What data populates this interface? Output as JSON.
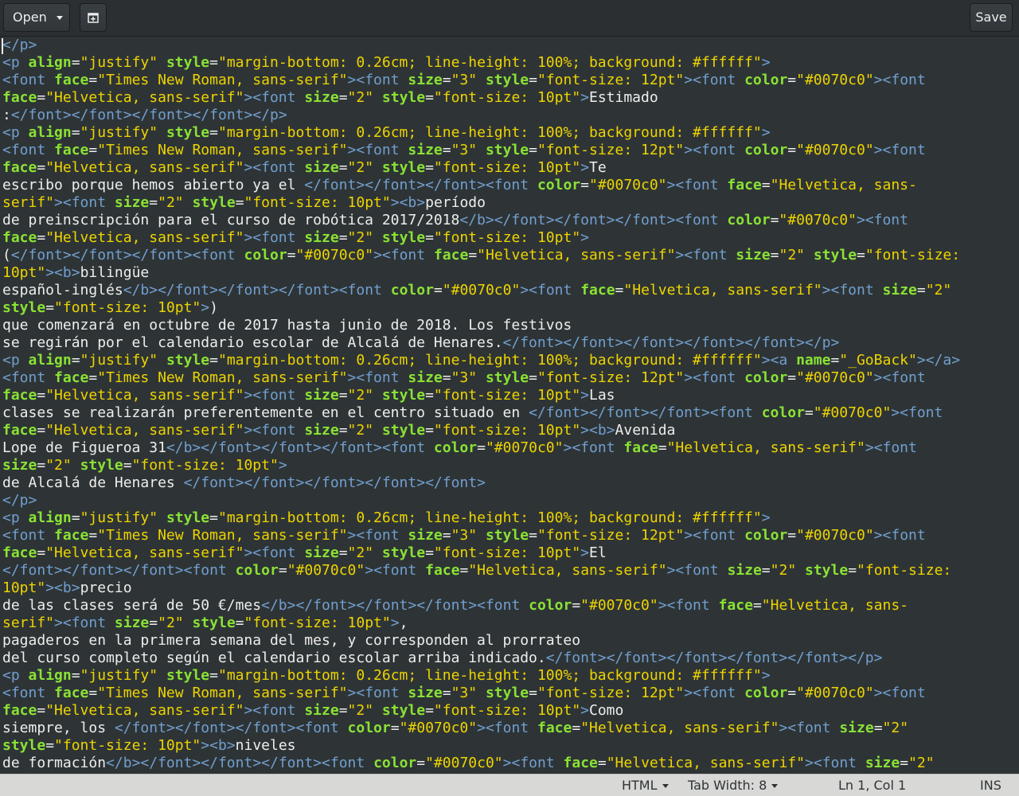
{
  "header": {
    "open_label": "Open",
    "save_label": "Save",
    "new_tab_icon": "new-tab-icon"
  },
  "editor": {
    "lines": [
      "</p>",
      "<p align=\"justify\" style=\"margin-bottom: 0.26cm; line-height: 100%; background: #ffffff\">",
      "<font face=\"Times New Roman, sans-serif\"><font size=\"3\" style=\"font-size: 12pt\"><font color=\"#0070c0\"><font",
      "face=\"Helvetica, sans-serif\"><font size=\"2\" style=\"font-size: 10pt\">Estimado",
      ":</font></font></font></font></p>",
      "<p align=\"justify\" style=\"margin-bottom: 0.26cm; line-height: 100%; background: #ffffff\">",
      "<font face=\"Times New Roman, sans-serif\"><font size=\"3\" style=\"font-size: 12pt\"><font color=\"#0070c0\"><font",
      "face=\"Helvetica, sans-serif\"><font size=\"2\" style=\"font-size: 10pt\">Te",
      "escribo porque hemos abierto ya el </font></font></font><font color=\"#0070c0\"><font face=\"Helvetica, sans-",
      "serif\"><font size=\"2\" style=\"font-size: 10pt\"><b>período",
      "de preinscripción para el curso de robótica 2017/2018</b></font></font></font><font color=\"#0070c0\"><font",
      "face=\"Helvetica, sans-serif\"><font size=\"2\" style=\"font-size: 10pt\">",
      "(</font></font></font><font color=\"#0070c0\"><font face=\"Helvetica, sans-serif\"><font size=\"2\" style=\"font-size:",
      "10pt\"><b>bilingüe",
      "español-inglés</b></font></font></font><font color=\"#0070c0\"><font face=\"Helvetica, sans-serif\"><font size=\"2\"",
      "style=\"font-size: 10pt\">)",
      "que comenzará en octubre de 2017 hasta junio de 2018. Los festivos",
      "se regirán por el calendario escolar de Alcalá de Henares.</font></font></font></font></font></p>",
      "<p align=\"justify\" style=\"margin-bottom: 0.26cm; line-height: 100%; background: #ffffff\"><a name=\"_GoBack\"></a>",
      "<font face=\"Times New Roman, sans-serif\"><font size=\"3\" style=\"font-size: 12pt\"><font color=\"#0070c0\"><font",
      "face=\"Helvetica, sans-serif\"><font size=\"2\" style=\"font-size: 10pt\">Las",
      "clases se realizarán preferentemente en el centro situado en </font></font></font><font color=\"#0070c0\"><font",
      "face=\"Helvetica, sans-serif\"><font size=\"2\" style=\"font-size: 10pt\"><b>Avenida",
      "Lope de Figueroa 31</b></font></font></font><font color=\"#0070c0\"><font face=\"Helvetica, sans-serif\"><font",
      "size=\"2\" style=\"font-size: 10pt\">",
      "de Alcalá de Henares </font></font></font></font></font>",
      "</p>",
      "<p align=\"justify\" style=\"margin-bottom: 0.26cm; line-height: 100%; background: #ffffff\">",
      "<font face=\"Times New Roman, sans-serif\"><font size=\"3\" style=\"font-size: 12pt\"><font color=\"#0070c0\"><font",
      "face=\"Helvetica, sans-serif\"><font size=\"2\" style=\"font-size: 10pt\">El",
      "</font></font></font><font color=\"#0070c0\"><font face=\"Helvetica, sans-serif\"><font size=\"2\" style=\"font-size:",
      "10pt\"><b>precio",
      "de las clases será de 50 €/mes</b></font></font></font><font color=\"#0070c0\"><font face=\"Helvetica, sans-",
      "serif\"><font size=\"2\" style=\"font-size: 10pt\">,",
      "pagaderos en la primera semana del mes, y corresponden al prorrateo",
      "del curso completo según el calendario escolar arriba indicado.</font></font></font></font></font></p>",
      "<p align=\"justify\" style=\"margin-bottom: 0.26cm; line-height: 100%; background: #ffffff\">",
      "<font face=\"Times New Roman, sans-serif\"><font size=\"3\" style=\"font-size: 12pt\"><font color=\"#0070c0\"><font",
      "face=\"Helvetica, sans-serif\"><font size=\"2\" style=\"font-size: 10pt\">Como",
      "siempre, los </font></font></font><font color=\"#0070c0\"><font face=\"Helvetica, sans-serif\"><font size=\"2\"",
      "style=\"font-size: 10pt\"><b>niveles",
      "de formación</b></font></font></font><font color=\"#0070c0\"><font face=\"Helvetica, sans-serif\"><font size=\"2\""
    ]
  },
  "status": {
    "language": "HTML",
    "tab_width": "Tab Width: 8",
    "position": "Ln 1, Col 1",
    "mode": "INS"
  },
  "colors": {
    "editor_bg": "#2e3436",
    "tag": "#729fcf",
    "attribute": "#8ae234",
    "string": "#edd400",
    "text": "#eeeeec"
  }
}
